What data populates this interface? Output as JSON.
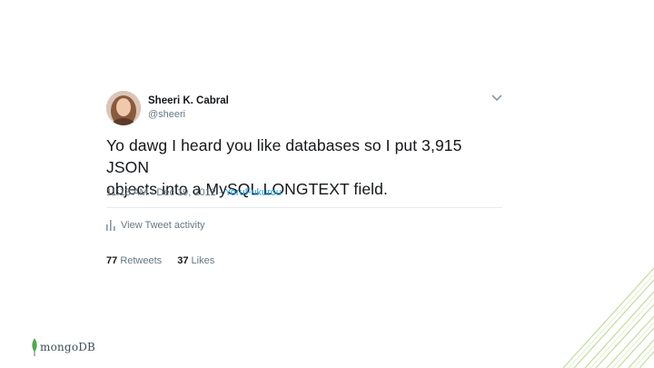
{
  "tweet": {
    "name": "Sheeri K. Cabral",
    "handle": "@sheeri",
    "text_line1": "Yo dawg I heard you like databases so I put 3,915 JSON",
    "text_line2": "objects into a MySQL LONGTEXT field.",
    "time": "11:13 AM · Dec 19, 2012 ·",
    "source": "YoruFukurou",
    "activity_label": "View Tweet activity",
    "retweets_count": "77",
    "retweets_label": "Retweets",
    "likes_count": "37",
    "likes_label": "Likes"
  },
  "logo": {
    "text": "mongoDB"
  },
  "colors": {
    "link": "#1da1f2",
    "muted": "#657786",
    "leaf": "#4fa94d",
    "stripes": "#8bc34a"
  },
  "icons": [
    "chevron-down-icon",
    "bar-chart-icon",
    "mongodb-leaf-icon"
  ]
}
